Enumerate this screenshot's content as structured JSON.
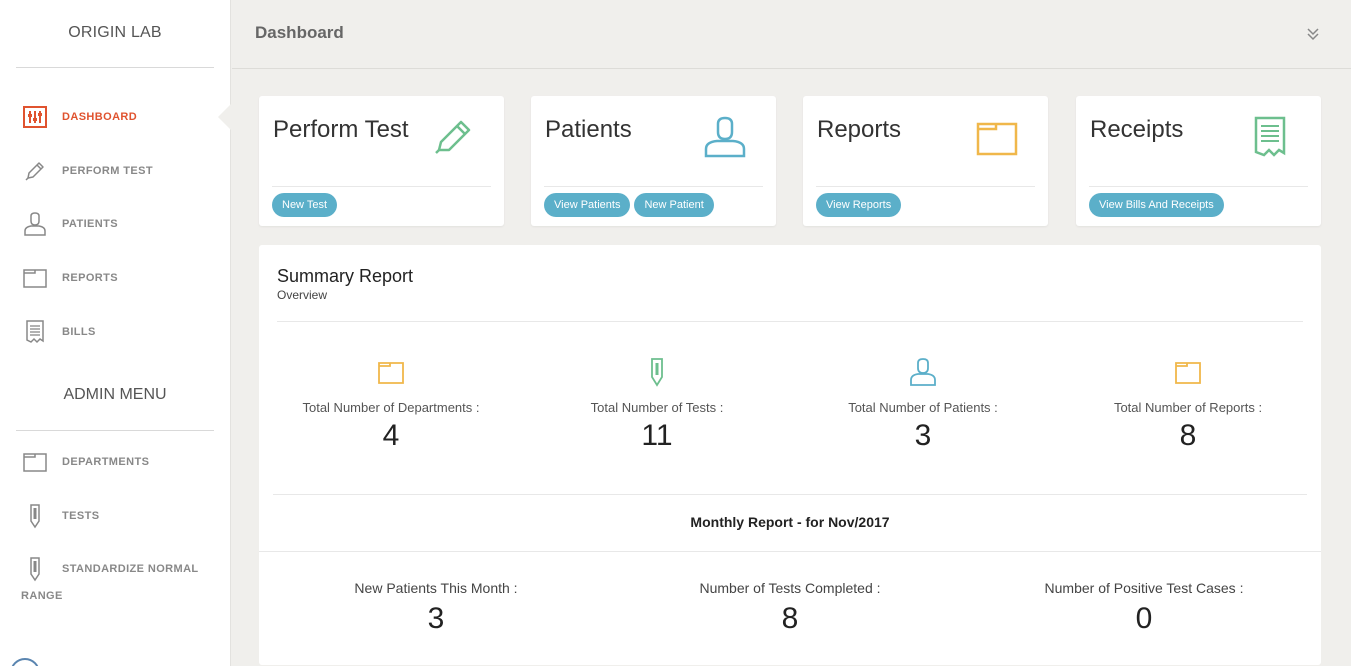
{
  "sidebar": {
    "brand": "ORIGIN LAB",
    "items": [
      {
        "label": "DASHBOARD",
        "icon": "dashboard-icon",
        "active": true
      },
      {
        "label": "PERFORM TEST",
        "icon": "pencil-icon"
      },
      {
        "label": "PATIENTS",
        "icon": "user-icon"
      },
      {
        "label": "REPORTS",
        "icon": "folder-icon"
      },
      {
        "label": "BILLS",
        "icon": "receipt-icon"
      }
    ],
    "admin_title": "ADMIN MENU",
    "admin_items": [
      {
        "label": "DEPARTMENTS",
        "icon": "folder-icon"
      },
      {
        "label": "TESTS",
        "icon": "test-tube-icon"
      },
      {
        "label": "STANDARDIZE NORMAL",
        "icon": "test-tube-icon"
      }
    ],
    "admin_items_continuation": "RANGE"
  },
  "header": {
    "title": "Dashboard",
    "collapse_icon": "double-chevron-down-icon"
  },
  "cards": [
    {
      "title": "Perform Test",
      "icon": "pencil-icon",
      "icon_color": "#6dbf8e",
      "actions": [
        "New Test"
      ]
    },
    {
      "title": "Patients",
      "icon": "user-icon",
      "icon_color": "#5bafc9",
      "actions": [
        "View Patients",
        "New Patient"
      ]
    },
    {
      "title": "Reports",
      "icon": "folder-icon",
      "icon_color": "#f0b74a",
      "actions": [
        "View Reports"
      ]
    },
    {
      "title": "Receipts",
      "icon": "receipt-icon",
      "icon_color": "#6dbf8e",
      "actions": [
        "View Bills And Receipts"
      ]
    }
  ],
  "summary": {
    "title": "Summary Report",
    "subtitle": "Overview",
    "stats": [
      {
        "label": "Total Number of Departments :",
        "value": "4",
        "icon": "folder-icon",
        "color": "#f0b74a"
      },
      {
        "label": "Total Number of Tests :",
        "value": "11",
        "icon": "test-tube-icon",
        "color": "#6dbf8e"
      },
      {
        "label": "Total Number of Patients :",
        "value": "3",
        "icon": "user-icon",
        "color": "#5bafc9"
      },
      {
        "label": "Total Number of Reports :",
        "value": "8",
        "icon": "folder-icon",
        "color": "#f0b74a"
      }
    ]
  },
  "monthly": {
    "title": "Monthly Report - for Nov/2017",
    "stats": [
      {
        "label": "New Patients This Month :",
        "value": "3"
      },
      {
        "label": "Number of Tests Completed :",
        "value": "8"
      },
      {
        "label": "Number of Positive Test Cases :",
        "value": "0"
      }
    ]
  },
  "colors": {
    "accent": "#e0532f",
    "button": "#5bafc9",
    "background": "#f0efec"
  }
}
